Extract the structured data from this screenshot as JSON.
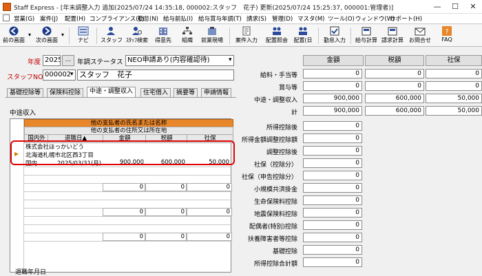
{
  "window": {
    "title": "Staff Express - [年末調整入力 追加(2025/07/24 14:35:18, 000002:スタッフ　花子) 更新(2025/07/24 15:25:37, 000001:管理者)]",
    "minimize": "—",
    "maximize": "☐",
    "close": "✕"
  },
  "menu": [
    "営業(G)",
    "案件(J)",
    "配置(H)",
    "コンプライアンス(C)",
    "勤怠(N)",
    "給与前払(I)",
    "給与賞与年調(T)",
    "請求(S)",
    "管理(D)",
    "マスタ(M)",
    "ツール(O)",
    "ウィンドウ(W)",
    "サポート(H)"
  ],
  "toolbar": {
    "back": "前の画面",
    "next": "次の画面",
    "navi": "ナビ",
    "staff": "スタッフ",
    "staff_search": "ｽﾀｯﾌ検索",
    "client": "得意先",
    "org": "組織",
    "site": "就業現場",
    "job_entry": "案件入力",
    "assign_ref": "配置照会",
    "assign_day": "配置(日",
    "attendance_entry": "勤怠入力",
    "payroll_calc": "給与計算",
    "billing_calc": "請求計算",
    "inquiry": "お問合せ",
    "faq": "FAQ"
  },
  "form": {
    "year_label": "年度",
    "year_value": "2025",
    "year_btn": "...",
    "status_label": "年調ステータス",
    "status_value": "NEO申請あり(内容確認待)",
    "staff_no_label": "スタッフNO",
    "staff_no_value": "000002",
    "staff_name": "スタッフ　花子"
  },
  "tabs": [
    "基礎控除等",
    "保険料控除",
    "中途・調整収入",
    "住宅借入",
    "摘要等",
    "申請情報"
  ],
  "panel": {
    "section_label": "中途収入",
    "grid": {
      "header_top1": "他の支払者の氏名または名称",
      "header_top2": "他の支払者の住所又は所在地",
      "columns": [
        "国内外",
        "退職日▲",
        "金額",
        "税額",
        "社保"
      ],
      "rows": [
        {
          "name": "株式会社ほっかいどう",
          "address": "北海道札幌市北区西3丁目",
          "country": "国内",
          "date": "2025/03/31(月)",
          "amount": "900,000",
          "tax": "600,000",
          "social": "50,000"
        },
        {
          "amount": "0",
          "tax": "0",
          "social": "0"
        },
        {
          "amount": "0",
          "tax": "0",
          "social": "0"
        },
        {
          "amount": "0",
          "tax": "0",
          "social": "0"
        }
      ]
    },
    "bottom_label": "退職年月日"
  },
  "summary": {
    "headers": [
      "金額",
      "税額",
      "社保"
    ],
    "rows": [
      {
        "label": "給料・手当等",
        "amount": "0",
        "tax": "0",
        "social": "0"
      },
      {
        "label": "賞与等",
        "amount": "0",
        "tax": "0",
        "social": "0"
      },
      {
        "label": "中途・調整収入",
        "amount": "900,000",
        "tax": "600,000",
        "social": "50,000"
      },
      {
        "label": "計",
        "amount": "900,000",
        "tax": "600,000",
        "social": "50,000"
      }
    ],
    "deductions": [
      {
        "label": "所得控除後",
        "value": "0"
      },
      {
        "label": "所得金額調整控除額",
        "value": "0"
      },
      {
        "label": "調整控除後",
        "value": "0"
      },
      {
        "label": "社保（控除分）",
        "value": "0"
      },
      {
        "label": "社保（申告控除分）",
        "value": "0"
      },
      {
        "label": "小規模共済掛金",
        "value": "0"
      },
      {
        "label": "生命保険料控除",
        "value": "0"
      },
      {
        "label": "地震保険料控除",
        "value": "0"
      },
      {
        "label": "配偶者(特別)控除",
        "value": "0"
      },
      {
        "label": "扶養障害者等控除",
        "value": "0"
      },
      {
        "label": "基礎控除",
        "value": "0"
      },
      {
        "label": "所得控除合計額",
        "value": "0"
      }
    ]
  },
  "colors": {
    "accent": "#e8862a",
    "highlight": "#e00000",
    "staff_label": "#c00000"
  }
}
